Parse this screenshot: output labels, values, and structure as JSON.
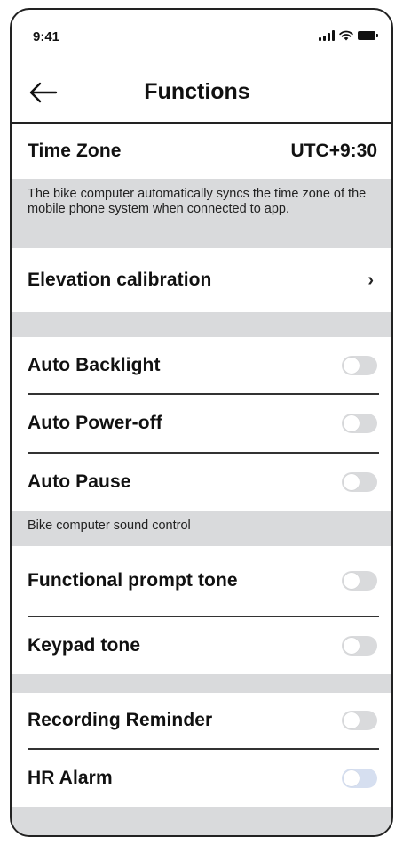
{
  "status_bar": {
    "time": "9:41"
  },
  "header": {
    "title": "Functions"
  },
  "time_zone": {
    "label": "Time Zone",
    "value": "UTC+9:30",
    "note": "The bike computer automatically syncs the time zone of the mobile phone system when connected to app."
  },
  "elevation": {
    "label": "Elevation calibration",
    "chevron": "›"
  },
  "general_toggles": [
    {
      "label": "Auto Backlight",
      "on": false
    },
    {
      "label": "Auto Power-off",
      "on": false
    },
    {
      "label": "Auto Pause",
      "on": false
    }
  ],
  "sound_section": {
    "caption": "Bike computer sound control"
  },
  "sound_toggles": [
    {
      "label": "Functional prompt tone",
      "on": false
    },
    {
      "label": "Keypad tone",
      "on": false
    }
  ],
  "alert_toggles": [
    {
      "label": "Recording Reminder",
      "on": false
    },
    {
      "label": "HR Alarm",
      "on": false
    }
  ],
  "colors": {
    "section_gray": "#d9dadc",
    "toggle_off": "#d9dadc",
    "text": "#111111"
  }
}
